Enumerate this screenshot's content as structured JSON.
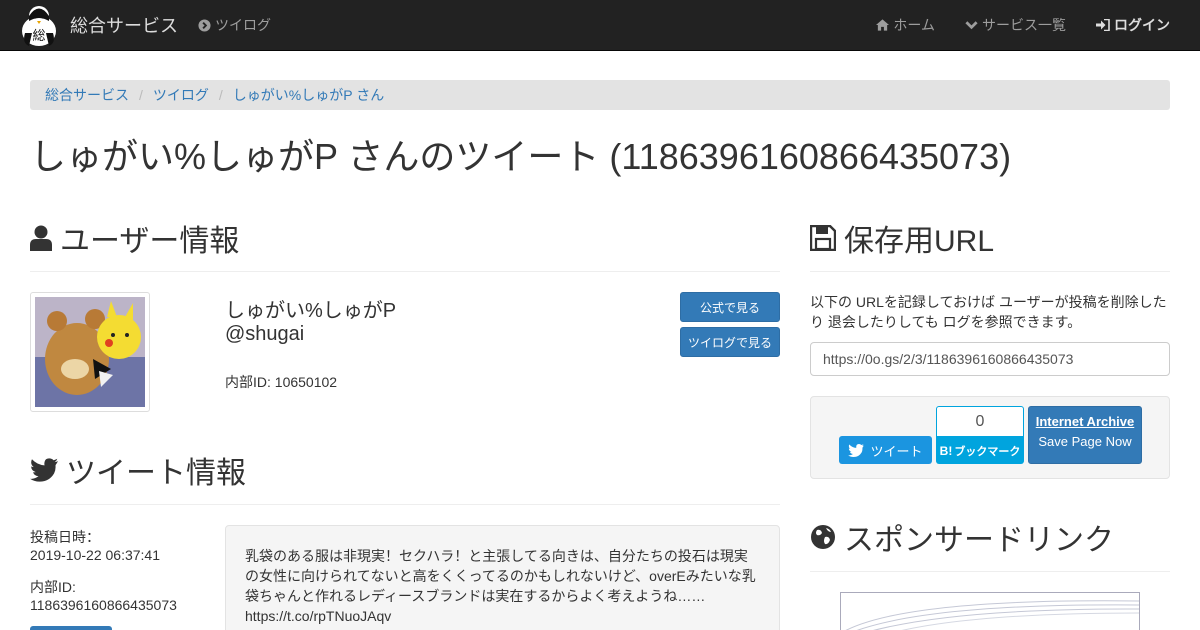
{
  "navbar": {
    "brand": "総合サービス",
    "brand_logo_text": "総",
    "left_link": "ツイログ",
    "home": "ホーム",
    "services": "サービス一覧",
    "login": "ログイン"
  },
  "breadcrumb": [
    "総合サービス",
    "ツイログ",
    "しゅがい%しゅがP さん"
  ],
  "page_title": "しゅがい%しゅがP さんのツイート (1186396160866435073)",
  "user_section": {
    "heading": "ユーザー情報",
    "name": "しゅがい%しゅがP",
    "handle": "@shugai",
    "internal_id": "内部ID: 10650102",
    "btn_official": "公式で見る",
    "btn_twilog": "ツイログで見る"
  },
  "tweet_section": {
    "heading": "ツイート情報",
    "date_label": "投稿日時：",
    "date_value": "2019-10-22 06:37:41",
    "id_label": "内部ID:",
    "id_value": "1186396160866435073",
    "text": "乳袋のある服は非現実！セクハラ！と主張してる向きは、自分たちの投石は現実の女性に向けられてないと高をくくってるのかもしれないけど、overEみたいな乳袋ちゃんと作れるレディースブランドは実在するからよく考えようね…… https://t.co/rpTNuoJAqv"
  },
  "save_section": {
    "heading": "保存用URL",
    "description": "以下の URLを記録しておけば ユーザーが投稿を削除したり 退会したりしても ログを参照できます。",
    "url": "https://0o.gs/2/3/1186396160866435073",
    "tweet_btn": "ツイート",
    "hatena_count": "0",
    "hatena_btn": "ブックマーク",
    "ia_title": "Internet Archive",
    "ia_sub": "Save Page Now"
  },
  "sponsor_section": {
    "heading": "スポンサードリンク"
  },
  "colors": {
    "navbar_bg": "#222222",
    "primary": "#337ab7",
    "twitter": "#1b95e0",
    "hatena": "#00a4de"
  }
}
